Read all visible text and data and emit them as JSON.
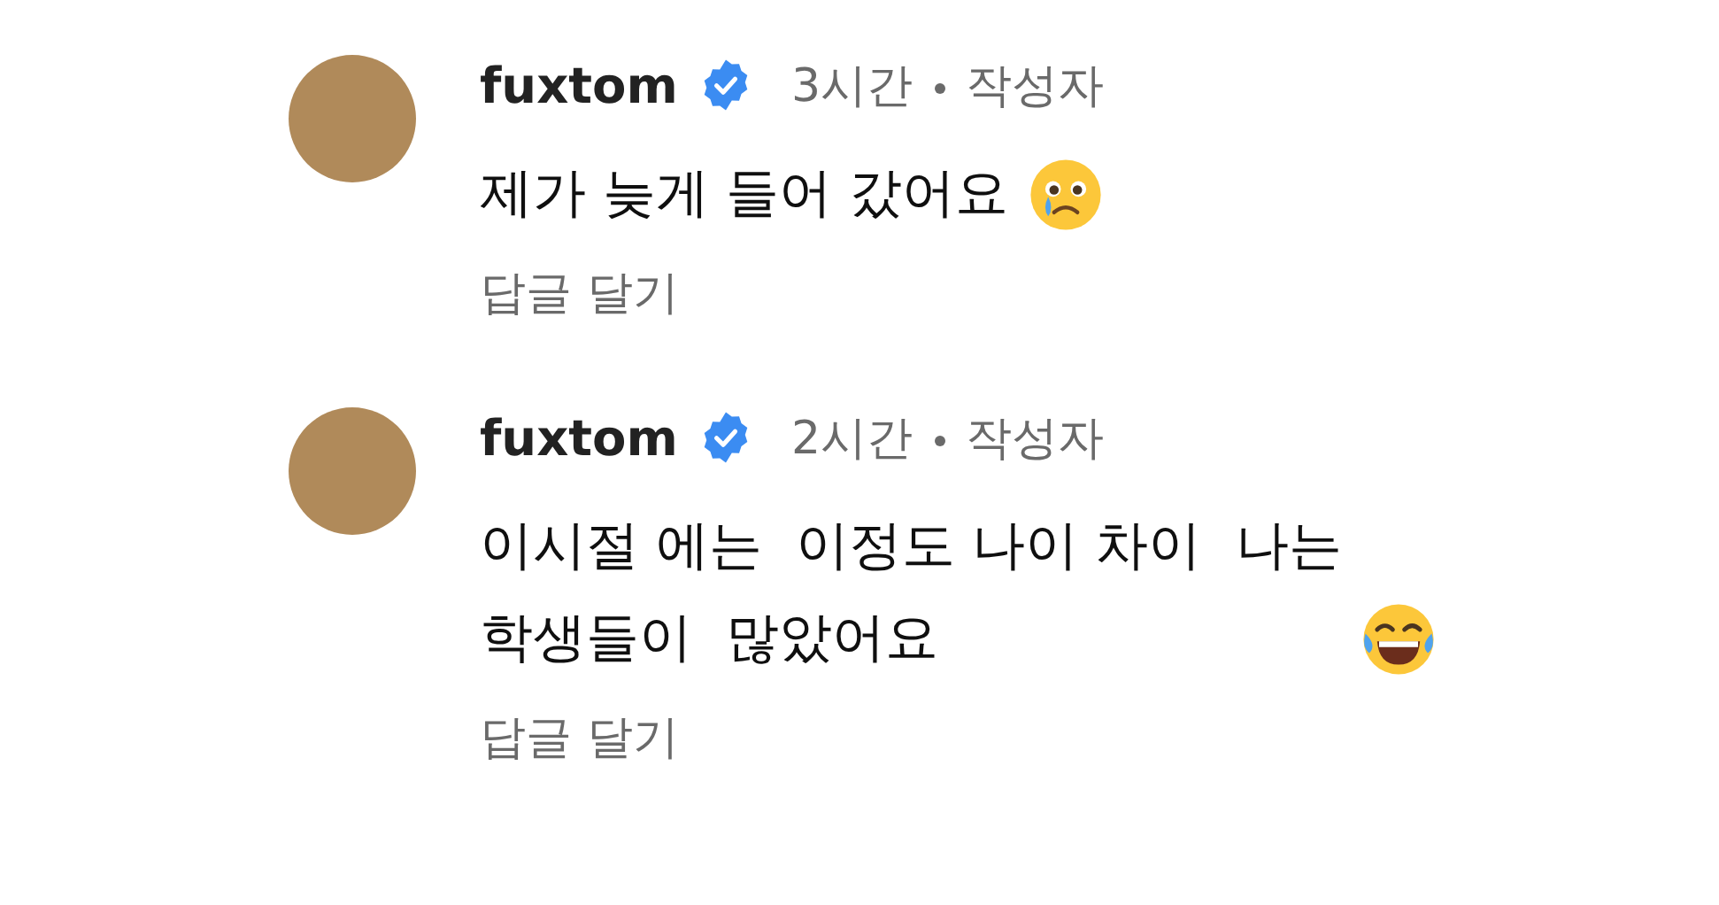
{
  "comments": [
    {
      "author": "fuxtom",
      "verified": true,
      "time": "3시간",
      "author_tag": "작성자",
      "text": "제가 늦게 들어 갔어요",
      "emoji": {
        "kind": "cry"
      },
      "reply": "답글 달기"
    },
    {
      "author": "fuxtom",
      "verified": true,
      "time": "2시간",
      "author_tag": "작성자",
      "text": "이시절 에는  이정도 나이 차이  나는\n학생들이  많았어요",
      "emoji": {
        "kind": "laugh"
      },
      "reply": "답글 달기"
    }
  ]
}
